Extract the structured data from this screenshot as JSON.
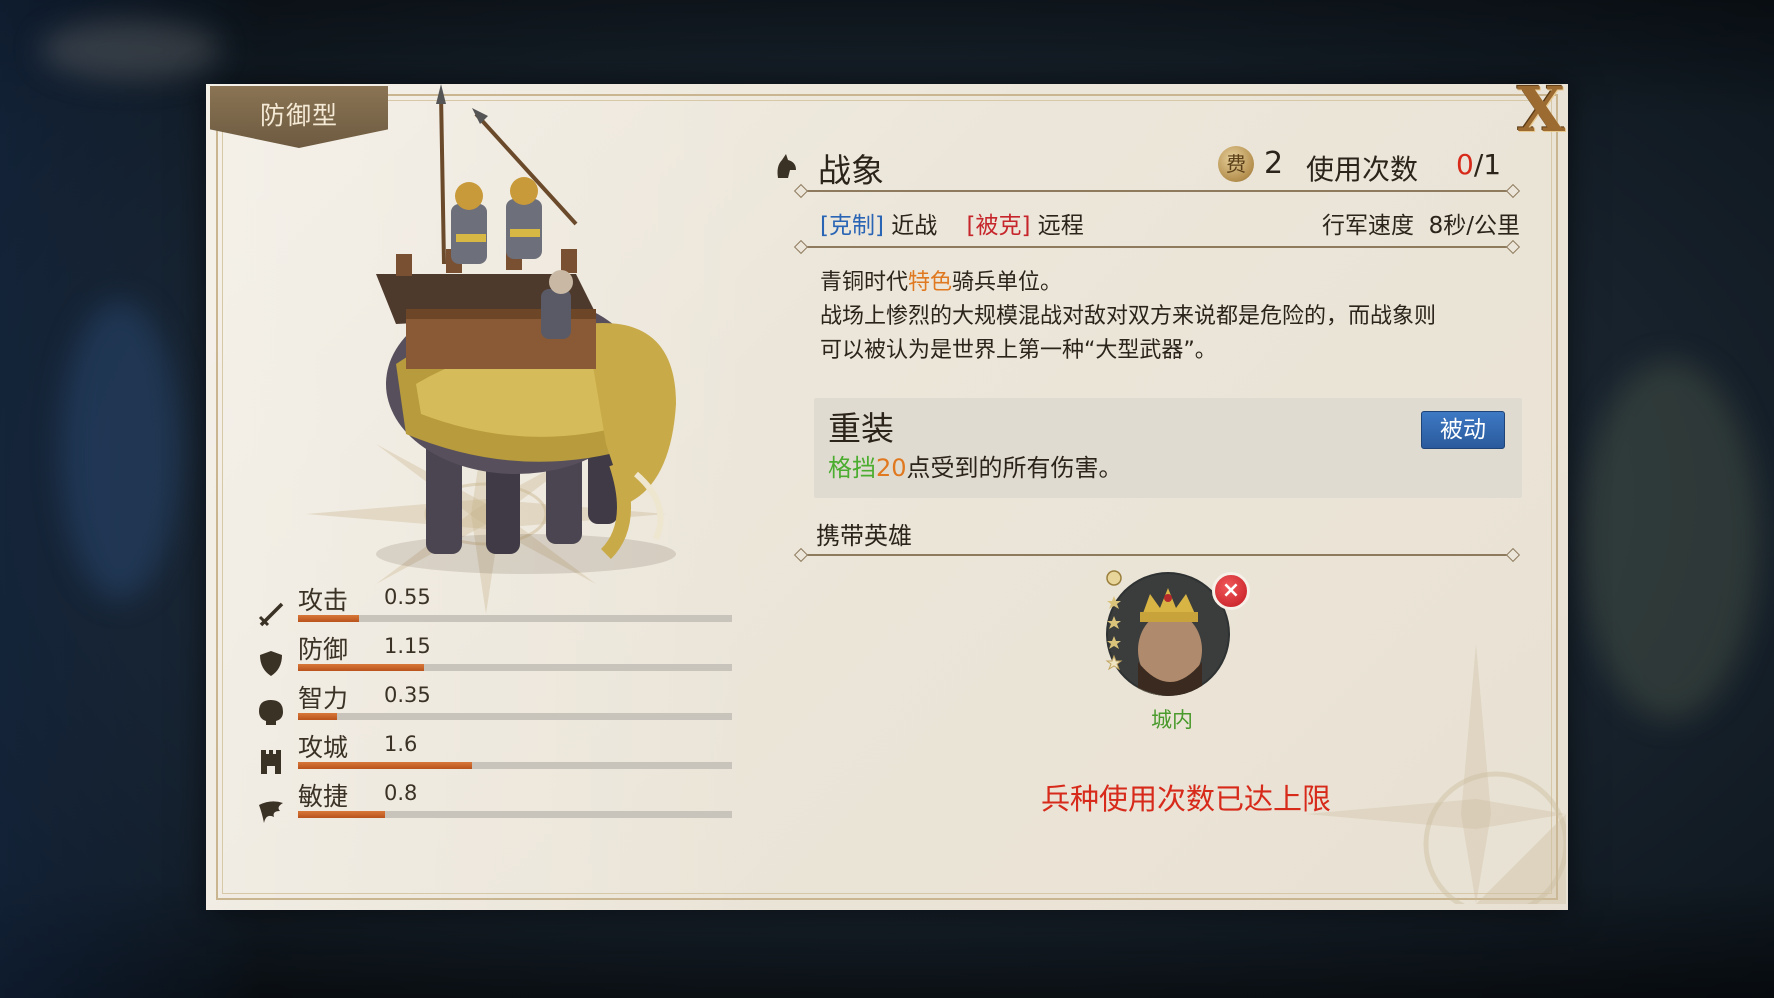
{
  "unit": {
    "type_tab": "防御型",
    "name": "战象",
    "cost": "2",
    "cost_icon_char": "费",
    "uses_label": "使用次数",
    "uses_current": "0",
    "uses_max": "/1",
    "counter_tag": "[克制]",
    "counter_target": "近战",
    "weak_tag": "[被克]",
    "weak_target": "远程",
    "march_label": "行军速度",
    "march_value": "8秒/公里",
    "desc_line1_pre": "青铜时代",
    "desc_line1_hl": "特色",
    "desc_line1_post": "骑兵单位。",
    "desc_line2": "战场上惨烈的大规模混战对敌对双方来说都是危险的，而战象则",
    "desc_line3": "可以被认为是世界上第一种“大型武器”。"
  },
  "skill": {
    "name": "重装",
    "badge": "被动",
    "desc_keyword": "格挡",
    "desc_number": "20",
    "desc_rest": "点受到的所有伤害。"
  },
  "hero": {
    "section_label": "携带英雄",
    "status": "城内",
    "remove_icon": "×"
  },
  "limit_message": "兵种使用次数已达上限",
  "close_label": "X",
  "stats": [
    {
      "name": "攻击",
      "value": "0.55",
      "fill": 0.14,
      "icon": "sword-icon"
    },
    {
      "name": "防御",
      "value": "1.15",
      "fill": 0.29,
      "icon": "shield-icon"
    },
    {
      "name": "智力",
      "value": "0.35",
      "fill": 0.09,
      "icon": "head-icon"
    },
    {
      "name": "攻城",
      "value": "1.6",
      "fill": 0.4,
      "icon": "tower-icon"
    },
    {
      "name": "敏捷",
      "value": "0.8",
      "fill": 0.2,
      "icon": "wing-icon"
    }
  ],
  "colors": {
    "accent_red": "#d72a1a",
    "counter_blue": "#2a65b5",
    "weak_red": "#c6262b",
    "highlight_orange": "#e0781f",
    "keyword_green": "#4bad2f",
    "stat_fill": "#c8642a",
    "status_green": "#4a9a2c"
  }
}
